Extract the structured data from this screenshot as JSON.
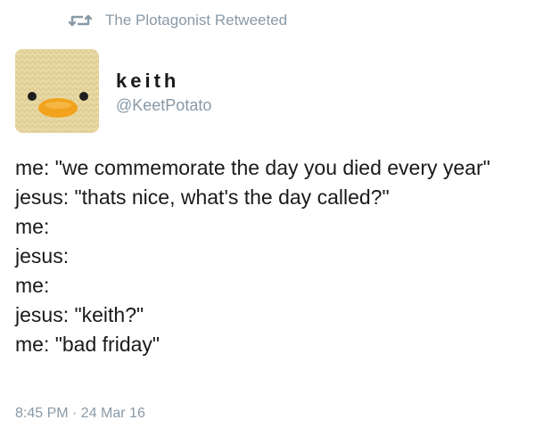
{
  "retweet": {
    "icon": "retweet-icon",
    "label": "The Plotagonist Retweeted"
  },
  "author": {
    "avatar_icon": "duck-avatar",
    "display_name": "keith",
    "handle": "@KeetPotato"
  },
  "tweet": {
    "lines": [
      "me: \"we commemorate the day you died every year\"",
      "jesus: \"thats nice, what's the day called?\"",
      "me:",
      "jesus:",
      "me:",
      "jesus: \"keith?\"",
      "me: \"bad friday\""
    ],
    "timestamp": "8:45 PM · 24 Mar 16"
  },
  "colors": {
    "muted": "#8899a6",
    "text": "#1a1a1a",
    "avatar_bg": "#e6d6a0",
    "beak": "#f0a01e"
  }
}
